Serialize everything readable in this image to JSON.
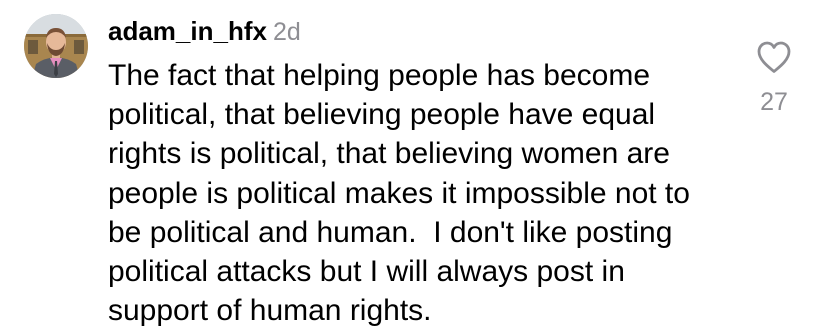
{
  "comment": {
    "username": "adam_in_hfx",
    "timestamp": "2d",
    "text": "The fact that helping people has become political, that believing people have equal rights is political, that believing women are people is political makes it impossible not to be political and human.  I don't like posting political attacks but I will always post in support of human rights.",
    "like_count": "27",
    "avatar_icon": "profile-photo",
    "like_icon": "heart-outline-icon"
  },
  "colors": {
    "text": "#000000",
    "secondary": "#8e8e93",
    "background": "#ffffff"
  }
}
